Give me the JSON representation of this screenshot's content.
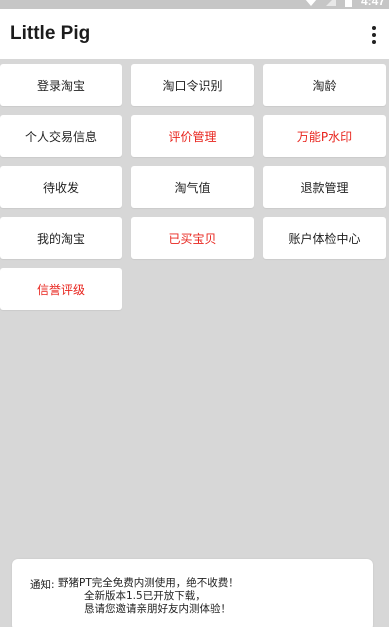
{
  "status_bar": {
    "time": "4:47",
    "icons": [
      "wifi-icon",
      "signal-icon",
      "battery-icon"
    ]
  },
  "app_bar": {
    "title": "Little Pig",
    "menu_icon": "more-vertical-icon"
  },
  "grid": {
    "buttons": [
      {
        "label": "登录淘宝",
        "color": "#1f1f1f"
      },
      {
        "label": "淘口令识别",
        "color": "#1f1f1f"
      },
      {
        "label": "淘龄",
        "color": "#1f1f1f"
      },
      {
        "label": "个人交易信息",
        "color": "#1f1f1f"
      },
      {
        "label": "评价管理",
        "color": "#e8241d"
      },
      {
        "label": "万能P水印",
        "color": "#e8241d"
      },
      {
        "label": "待收发",
        "color": "#1f1f1f"
      },
      {
        "label": "淘气值",
        "color": "#1f1f1f"
      },
      {
        "label": "退款管理",
        "color": "#1f1f1f"
      },
      {
        "label": "我的淘宝",
        "color": "#1f1f1f"
      },
      {
        "label": "已买宝贝",
        "color": "#e8241d"
      },
      {
        "label": "账户体检中心",
        "color": "#1f1f1f"
      },
      {
        "label": "信誉评级",
        "color": "#e8241d"
      }
    ]
  },
  "notice": {
    "label": "通知:",
    "lines": [
      "野猪PT完全免费内测使用，绝不收费！",
      "全新版本1.5已开放下载，",
      "恳请您邀请亲朋好友内测体验！"
    ]
  },
  "colors": {
    "background": "#d7d7d7",
    "card": "#ffffff",
    "accent_red": "#e8241d",
    "text": "#1f1f1f"
  }
}
